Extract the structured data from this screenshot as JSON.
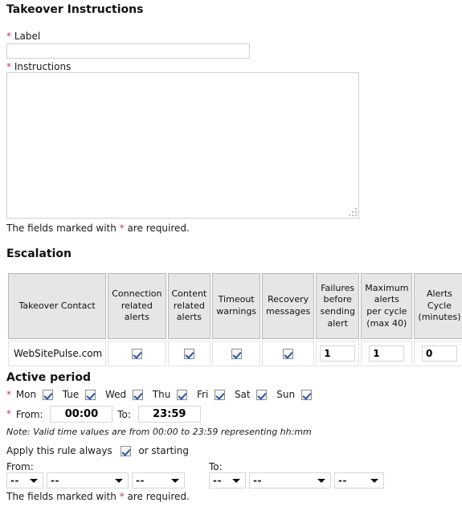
{
  "takeover": {
    "section_title": "Takeover Instructions",
    "label_field": {
      "label": "Label",
      "value": "",
      "placeholder": ""
    },
    "instructions_field": {
      "label": "Instructions",
      "value": "",
      "placeholder": ""
    },
    "required_note_prefix": "The fields marked with ",
    "required_note_star": "*",
    "required_note_suffix": " are required."
  },
  "escalation": {
    "section_title": "Escalation",
    "columns": [
      "Takeover Contact",
      "Connection related alerts",
      "Content related alerts",
      "Timeout warnings",
      "Recovery messages",
      "Failures before sending alert",
      "Maximum alerts per cycle (max 40)",
      "Alerts Cycle (minutes)"
    ],
    "column_lines": {
      "contact": [
        "Takeover Contact"
      ],
      "connection": [
        "Connection",
        "related",
        "alerts"
      ],
      "content": [
        "Content",
        "related",
        "alerts"
      ],
      "timeout": [
        "Timeout",
        "warnings"
      ],
      "recovery": [
        "Recovery",
        "messages"
      ],
      "failures": [
        "Failures",
        "before",
        "sending",
        "alert"
      ],
      "maximum": [
        "Maximum",
        "alerts",
        "per cycle",
        "(max 40)"
      ],
      "cycle": [
        "Alerts",
        "Cycle",
        "(minutes)"
      ]
    },
    "row": {
      "contact": "WebSitePulse.com",
      "connection_alerts_checked": true,
      "content_alerts_checked": true,
      "timeout_warnings_checked": true,
      "recovery_messages_checked": true,
      "failures_before_sending_alert": "1",
      "maximum_alerts_per_cycle": "1",
      "alerts_cycle_minutes": "0"
    }
  },
  "active_period": {
    "section_title": "Active period",
    "days": [
      {
        "name": "Mon",
        "checked": true
      },
      {
        "name": "Tue",
        "checked": true
      },
      {
        "name": "Wed",
        "checked": true
      },
      {
        "name": "Thu",
        "checked": true
      },
      {
        "name": "Fri",
        "checked": true
      },
      {
        "name": "Sat",
        "checked": true
      },
      {
        "name": "Sun",
        "checked": true
      }
    ],
    "from_label": "From:",
    "from_value": "00:00",
    "to_label": "To:",
    "to_value": "23:59",
    "time_note": "Note: Valid time values are from 00:00 to 23:59 representing hh:mm",
    "apply_always_label": "Apply this rule always",
    "apply_always_checked": true,
    "or_starting_label": "or starting",
    "range_from_label": "From:",
    "range_to_label": "To:",
    "from_selects": [
      {
        "value": "--"
      },
      {
        "value": "--"
      },
      {
        "value": "--"
      }
    ],
    "to_selects": [
      {
        "value": "--"
      },
      {
        "value": "--"
      },
      {
        "value": "--"
      }
    ],
    "required_note_prefix": "The fields marked with ",
    "required_note_star": "*",
    "required_note_suffix": " are required."
  },
  "colors": {
    "required_star": "#cc3355",
    "table_header_bg": "#e6e6e6",
    "table_header_border": "#b7b7b7",
    "checkbox_check": "#2b55a8",
    "input_border": "#d3d6dc",
    "text": "#1a1a1a"
  }
}
